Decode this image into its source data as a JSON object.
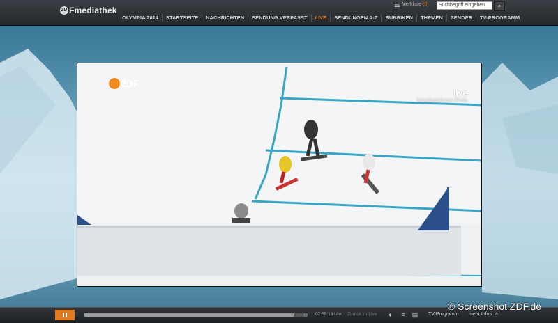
{
  "header": {
    "logo_badge": "2D",
    "logo_text": "Fmediathek",
    "merkliste_label": "Merkliste",
    "merkliste_count": "(0)",
    "search_placeholder": "Suchbegriff eingeben",
    "nav": [
      {
        "label": "OLYMPIA 2014"
      },
      {
        "label": "STARTSEITE"
      },
      {
        "label": "NACHRICHTEN"
      },
      {
        "label": "SENDUNG VERPASST"
      },
      {
        "label": "LIVE"
      },
      {
        "label": "SENDUNGEN A-Z"
      },
      {
        "label": "RUBRIKEN"
      },
      {
        "label": "THEMEN"
      },
      {
        "label": "SENDER"
      },
      {
        "label": "TV-PROGRAMM"
      }
    ],
    "colors": {
      "accent": "#e07a1f",
      "bar": "#2b2e32"
    }
  },
  "video": {
    "watermark": "2DF",
    "live_label": "live",
    "subtitle": "Snowboardcross Finals"
  },
  "player": {
    "time": "07:55:18 Uhr",
    "back_to_live": "Zurück zu Live",
    "tv_programm": "TV-Programm",
    "mehr_infos": "mehr Infos",
    "progress_fraction": 0.98,
    "icons": [
      "pause-icon",
      "volume-icon",
      "settings-icon",
      "chat-icon",
      "chevron-up-icon"
    ]
  },
  "copyright": "© Screenshot ZDF.de"
}
